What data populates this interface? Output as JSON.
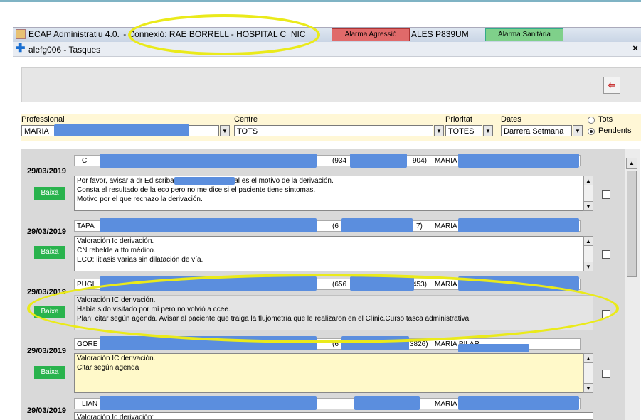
{
  "window": {
    "title_text": "ECAP Administratiu 4.0.",
    "connexio": "- Connexió: RAE BORRELL - HOSPITAL C",
    "trail1": "NIC",
    "alarm_agressio": "Alarma Agressió",
    "trail2": "ALES P839UM",
    "alarm_sanitaria": "Alarma Sanitària"
  },
  "subwindow": {
    "title": "alefg006 - Tasques",
    "close": "×"
  },
  "toolbar": {
    "exit_icon": "exit-door-icon",
    "exit_glyph": "⇦"
  },
  "filters": {
    "professional_label": "Professional",
    "professional_value": "MARIA",
    "centre_label": "Centre",
    "centre_value": "TOTS",
    "prioritat_label": "Prioritat",
    "prioritat_value": "TOTES",
    "dates_label": "Dates",
    "dates_value": "Darrera Setmana",
    "radio_tots": "Tots",
    "radio_pendents": "Pendents",
    "selected_radio": "Pendents"
  },
  "tasks": [
    {
      "date": "29/03/2019",
      "head_left": "C",
      "phone_prefix": "(934",
      "phone_suffix": "904)",
      "assignee": "MARIA",
      "baixa": "Baixa",
      "lines": [
        "Por favor, avisar a dr Ed                        scriba en la hia clinica cual es el motivo de la derivación.",
        "Consta el resultado de la eco pero no me dice si el paciente tiene sintomas.",
        "Motivo por el que rechazo la derivación."
      ],
      "highlight": false
    },
    {
      "date": "29/03/2019",
      "head_left": "TAPA",
      "phone_prefix": "(6",
      "phone_suffix": "7)",
      "assignee": "MARIA",
      "baixa": "Baixa",
      "lines": [
        "Valoración Ic derivación.",
        "CN rebelde a tto médico.",
        "ECO: litiasis varias sin dilatación de vía."
      ],
      "highlight": false
    },
    {
      "date": "29/03/2019",
      "head_left": "PUGI",
      "phone_prefix": "(656",
      "phone_suffix": "453)",
      "assignee": "MARIA",
      "baixa": "Baixa",
      "lines": [
        "Valoración IC derivación.",
        "Había sido visitado por mí pero no volvió a ccee.",
        "Plan: citar según agenda. Avisar al paciente que traiga la flujometría que le realizaron en el Clínic.Curso tasca administrativa"
      ],
      "highlight": false
    },
    {
      "date": "29/03/2019",
      "head_left": "GORE",
      "phone_prefix": "(6",
      "phone_suffix": "3826)",
      "assignee": "MARIA PILAR",
      "baixa": "Baixa",
      "lines": [
        "Valoración IC derivación.",
        "Citar según agenda"
      ],
      "highlight": true
    },
    {
      "date": "29/03/2019",
      "head_left": "LIAN",
      "phone_prefix": "",
      "phone_suffix": "",
      "assignee": "MARIA",
      "baixa": "",
      "lines": [
        "Valoración Ic derivación:"
      ],
      "highlight": false
    }
  ],
  "colors": {
    "redaction": "#5b8ede",
    "baixa": "#29b34d",
    "annotation": "#eaea1a",
    "highlight_bg": "#fff9c9"
  }
}
